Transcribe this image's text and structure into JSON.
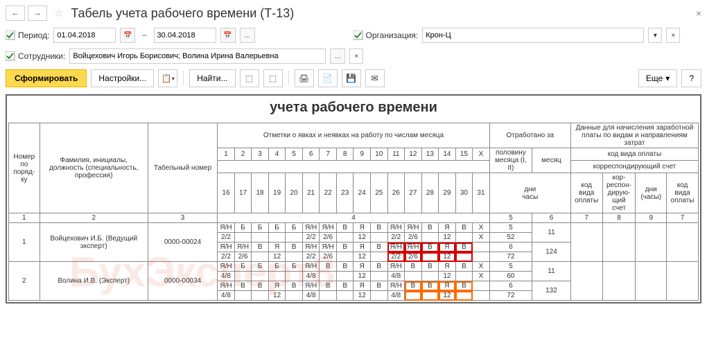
{
  "header": {
    "title": "Табель учета рабочего времени (Т-13)"
  },
  "filters": {
    "period_label": "Период:",
    "date_from": "01.04.2018",
    "date_to": "30.04.2018",
    "org_label": "Организация:",
    "org_value": "Крон-Ц",
    "emp_label": "Сотрудники:",
    "emp_value": "Войцехович Игорь Борисович; Волина Ирина Валерьевна",
    "dots": "..."
  },
  "toolbar": {
    "generate": "Сформировать",
    "settings": "Настройки...",
    "find": "Найти...",
    "more": "Еще",
    "help": "?"
  },
  "report": {
    "title": "учета  рабочего  времени",
    "cols": {
      "num": "Номер по поряд-ку",
      "fio": "Фамилия, инициалы, должность (специальность, профессия)",
      "tab": "Табельный номер",
      "marks": "Отметки о явках и неявках на работу по числам месяца",
      "worked": "Отработано за",
      "half": "половину месяца (I, II)",
      "month": "месяц",
      "days": "дни",
      "hours": "часы",
      "pay": "Данные для начисления заработной платы по видам и направлениям затрат",
      "pay_code_top": "код вида оплаты",
      "corr_top": "корреспондирующий счет",
      "c7": "код вида оплаты",
      "c8": "кор-респон-дирую-щий счет",
      "c9": "дни (часы)",
      "c10": "код вида оплаты"
    },
    "day_nums_1": [
      "1",
      "2",
      "3",
      "4",
      "5",
      "6",
      "7",
      "8",
      "9",
      "10",
      "11",
      "12",
      "13",
      "14",
      "15",
      "X"
    ],
    "day_nums_2": [
      "16",
      "17",
      "18",
      "19",
      "20",
      "21",
      "22",
      "23",
      "24",
      "25",
      "26",
      "27",
      "28",
      "29",
      "30",
      "31"
    ],
    "colnums": {
      "c1": "1",
      "c2": "2",
      "c3": "3",
      "c4": "4",
      "c5": "5",
      "c6": "6",
      "c7": "7",
      "c8": "8",
      "c9": "9",
      "c10": "7"
    },
    "rows": [
      {
        "num": "1",
        "fio": "Войцехович И.Б. (Ведущий эксперт)",
        "tab": "0000-00024",
        "r1": [
          "Я/Н",
          "Б",
          "Б",
          "Б",
          "Б",
          "Я/Н",
          "Я/Н",
          "В",
          "Я",
          "В",
          "Я/Н",
          "Я/Н",
          "В",
          "Я",
          "В",
          "X"
        ],
        "r2": [
          "2/2",
          "",
          "",
          "",
          "",
          "2/2",
          "2/6",
          "",
          "12",
          "",
          "2/2",
          "2/6",
          "",
          "12",
          "",
          "X"
        ],
        "r3": [
          "Я/Н",
          "Я/Н",
          "В",
          "Я",
          "В",
          "Я/Н",
          "Я/Н",
          "В",
          "Я",
          "В",
          "Я/Н",
          "Я/Н",
          "В",
          "Я",
          "В",
          ""
        ],
        "r4": [
          "2/2",
          "2/6",
          "",
          "12",
          "",
          "2/2",
          "2/6",
          "",
          "12",
          "",
          "2/2",
          "2/6",
          "",
          "12",
          "",
          ""
        ],
        "half": [
          "5",
          "52",
          "6",
          "72"
        ],
        "month": [
          "11",
          "124"
        ]
      },
      {
        "num": "2",
        "fio": "Волина И.В. (Эксперт)",
        "tab": "0000-00034",
        "r1": [
          "Я/Н",
          "Б",
          "Б",
          "Б",
          "Б",
          "Я/Н",
          "В",
          "В",
          "Я",
          "В",
          "Я/Н",
          "В",
          "В",
          "Я",
          "В",
          "X"
        ],
        "r2": [
          "4/8",
          "",
          "",
          "",
          "",
          "4/8",
          "",
          "",
          "12",
          "",
          "4/8",
          "",
          "",
          "12",
          "",
          "X"
        ],
        "r3": [
          "Я/Н",
          "В",
          "В",
          "Я",
          "В",
          "Я/Н",
          "В",
          "В",
          "Я",
          "В",
          "Я/Н",
          "В",
          "В",
          "Я",
          "В",
          ""
        ],
        "r4": [
          "4/8",
          "",
          "",
          "12",
          "",
          "4/8",
          "",
          "",
          "12",
          "",
          "4/8",
          "",
          "",
          "12",
          "",
          ""
        ],
        "half": [
          "5",
          "60",
          "6",
          "72"
        ],
        "month": [
          "11",
          "132"
        ]
      }
    ]
  }
}
